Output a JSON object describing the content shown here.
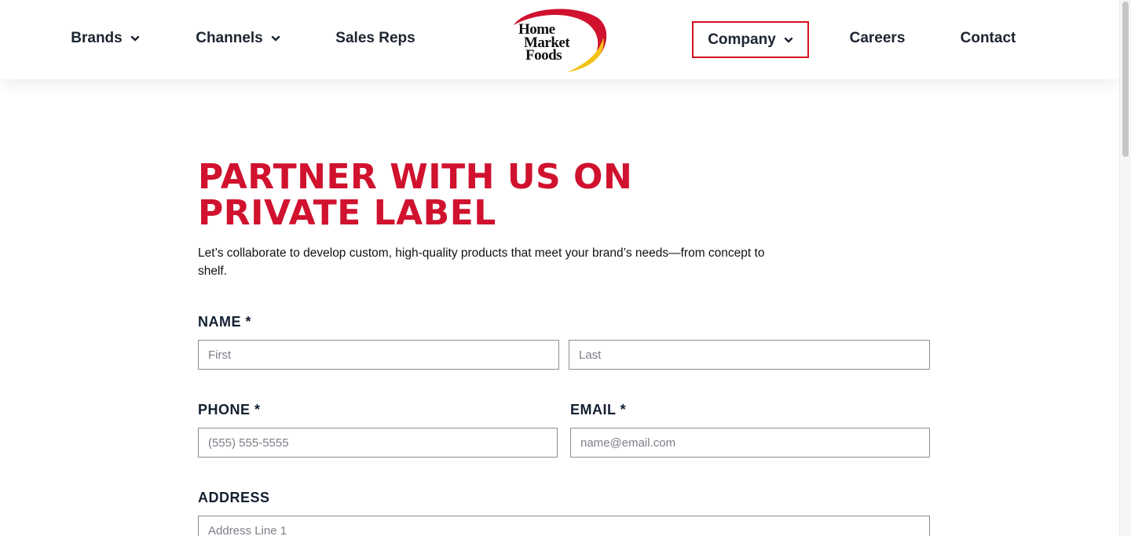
{
  "nav": {
    "brands": "Brands",
    "channels": "Channels",
    "sales_reps": "Sales Reps",
    "company": "Company",
    "careers": "Careers",
    "contact": "Contact"
  },
  "logo": {
    "line1": "Home",
    "line2": "Market",
    "line3": "Foods",
    "colors": {
      "arc_red": "#d0122e",
      "arc_yellow": "#f3c317"
    }
  },
  "main": {
    "heading": "PARTNER WITH US ON PRIVATE LABEL",
    "intro": "Let’s collaborate to develop custom, high-quality products that meet your brand’s needs—from concept to shelf."
  },
  "form": {
    "name_label": "NAME *",
    "first_placeholder": "First",
    "last_placeholder": "Last",
    "phone_label": "PHONE *",
    "phone_placeholder": "(555) 555-5555",
    "email_label": "EMAIL *",
    "email_placeholder": "name@email.com",
    "address_label": "ADDRESS",
    "address1_placeholder": "Address Line 1"
  },
  "colors": {
    "accent_red": "#d0122e",
    "focus_outline": "#d4101f",
    "text_dark": "#1c2430"
  },
  "icons": {
    "dropdown": "chevron-down-icon"
  }
}
